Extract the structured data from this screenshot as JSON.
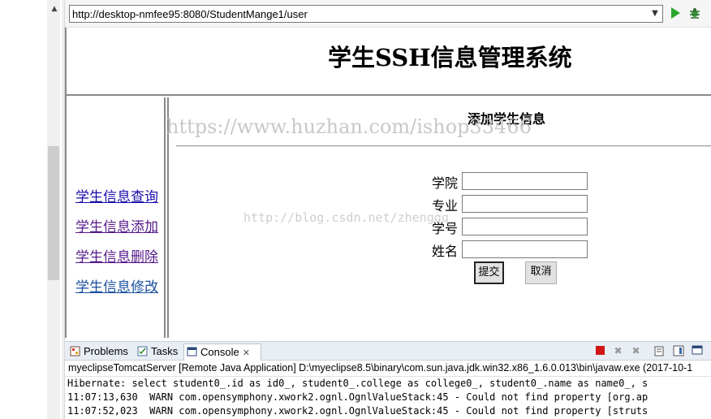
{
  "address_bar": {
    "url": "http://desktop-nmfee95:8080/StudentMange1/user",
    "go_icon": "play-icon",
    "debug_icon": "bug-icon"
  },
  "page": {
    "title": "学生SSH信息管理系统",
    "nav": [
      {
        "label": "学生信息查询",
        "color": "#1a0dab"
      },
      {
        "label": "学生信息添加",
        "color": "#551a8b"
      },
      {
        "label": "学生信息删除",
        "color": "#551a8b"
      },
      {
        "label": "学生信息修改",
        "color": "#1a4fa0"
      }
    ],
    "form": {
      "title": "添加学生信息",
      "fields": [
        {
          "label": "学院",
          "value": ""
        },
        {
          "label": "专业",
          "value": ""
        },
        {
          "label": "学号",
          "value": ""
        },
        {
          "label": "姓名",
          "value": ""
        }
      ],
      "submit_label": "提交",
      "cancel_label": "取消"
    },
    "watermarks": [
      "https://www.huzhan.com/ishop33466",
      "http://blog.csdn.net/zhengqq"
    ]
  },
  "console_panel": {
    "tabs": [
      {
        "label": "Problems",
        "icon": "problems-icon"
      },
      {
        "label": "Tasks",
        "icon": "tasks-icon"
      },
      {
        "label": "Console",
        "icon": "console-icon",
        "close": "✕"
      }
    ],
    "header": "myeclipseTomcatServer [Remote Java Application] D:\\myeclipse8.5\\binary\\com.sun.java.jdk.win32.x86_1.6.0.013\\bin\\javaw.exe (2017-10-1",
    "lines": [
      "Hibernate: select student0_.id as id0_, student0_.college as college0_, student0_.name as name0_, s",
      "11:07:13,630  WARN com.opensymphony.xwork2.ognl.OgnlValueStack:45 - Could not find property [org.ap",
      "11:07:52,023  WARN com.opensymphony.xwork2.ognl.OgnlValueStack:45 - Could not find property [struts"
    ],
    "accent": "#d11515"
  }
}
